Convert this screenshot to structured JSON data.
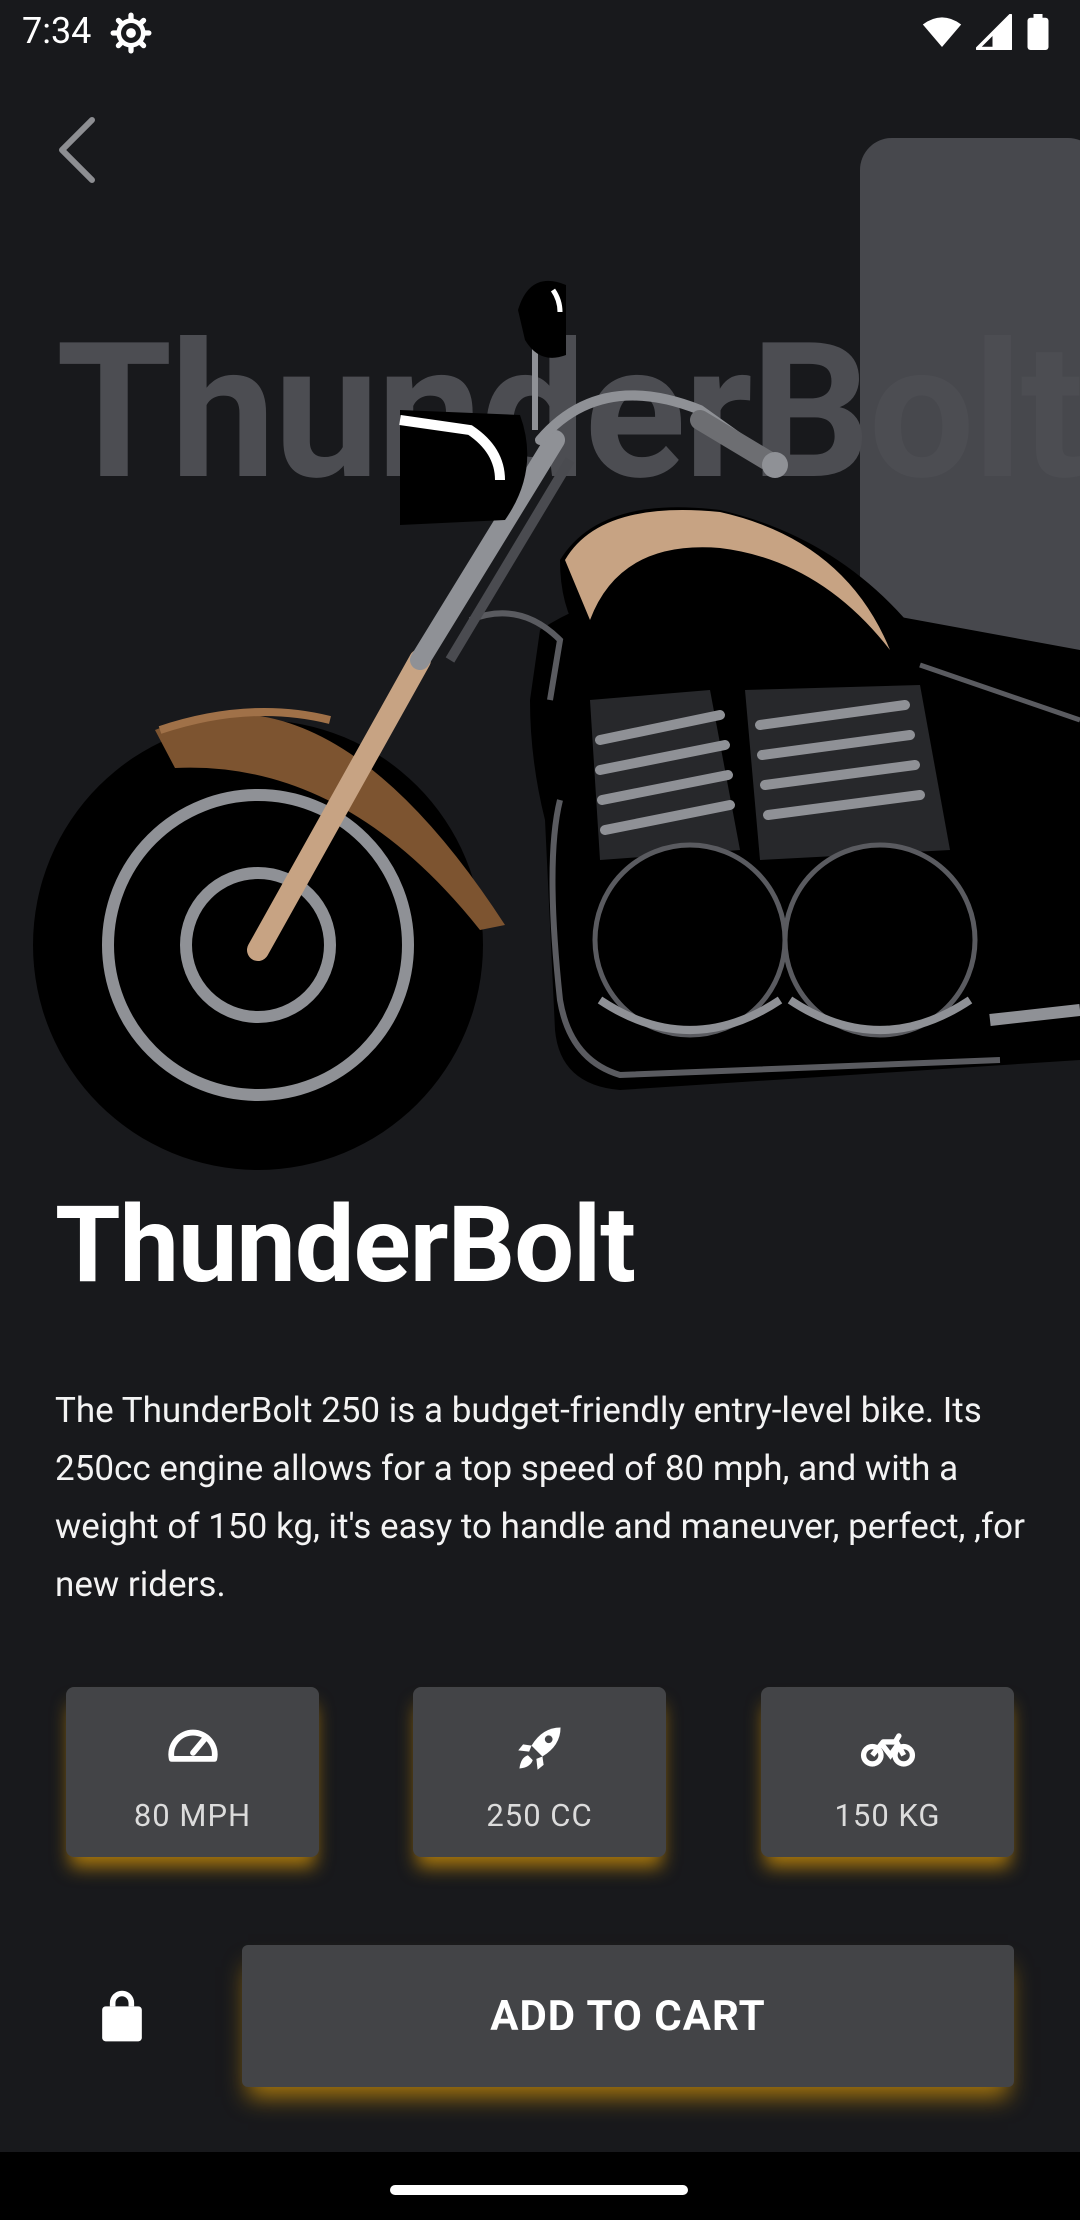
{
  "status_bar": {
    "time": "7:34"
  },
  "product": {
    "name": "ThunderBolt",
    "background_name": "ThunderBolt",
    "description": "The ThunderBolt 250 is a budget-friendly entry-level bike. Its 250cc engine allows for a top speed of 80 mph, and with a weight of 150 kg, it's easy to handle and maneuver, perfect, ,for new riders."
  },
  "specs": [
    {
      "icon": "speedometer-icon",
      "label": "80 MPH"
    },
    {
      "icon": "rocket-icon",
      "label": "250 CC"
    },
    {
      "icon": "motorcycle-icon",
      "label": "150 KG"
    }
  ],
  "actions": {
    "add_to_cart_label": "ADD TO CART"
  },
  "colors": {
    "background": "#18191c",
    "card": "#434447",
    "glow": "#d6960a",
    "hero_card": "#47484d"
  }
}
